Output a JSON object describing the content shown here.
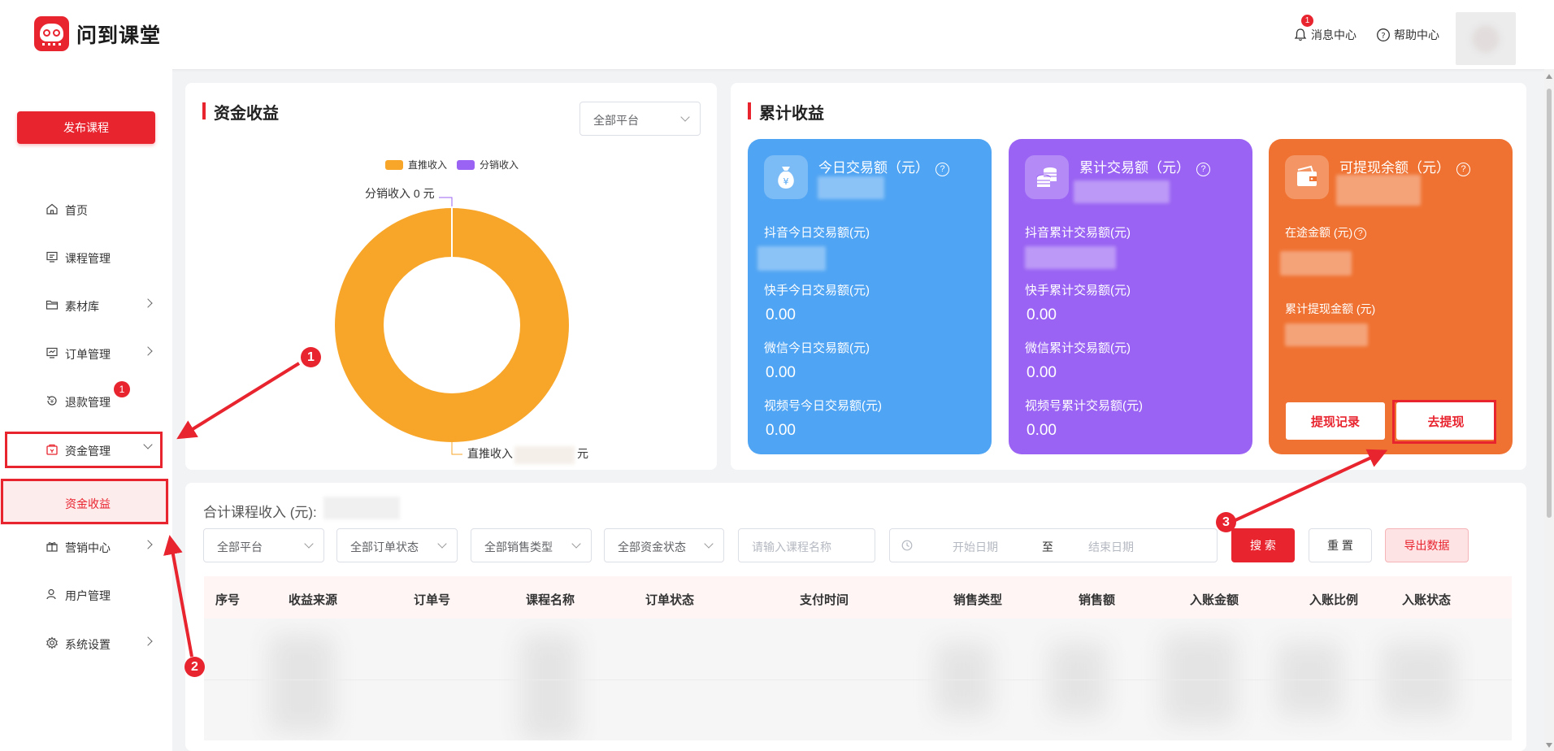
{
  "header": {
    "app_name": "问到课堂",
    "notifications_label": "消息中心",
    "notifications_badge": "1",
    "help_label": "帮助中心"
  },
  "sidebar": {
    "publish_label": "发布课程",
    "items": [
      {
        "label": "首页",
        "icon": "home-icon"
      },
      {
        "label": "课程管理",
        "icon": "course-icon"
      },
      {
        "label": "素材库",
        "icon": "folder-icon"
      },
      {
        "label": "订单管理",
        "icon": "order-icon"
      },
      {
        "label": "退款管理",
        "icon": "refund-icon",
        "badge": "1"
      },
      {
        "label": "资金管理",
        "icon": "wallet-icon"
      },
      {
        "label": "营销中心",
        "icon": "gift-icon"
      },
      {
        "label": "用户管理",
        "icon": "user-icon"
      },
      {
        "label": "系统设置",
        "icon": "settings-icon"
      }
    ],
    "sub_item": "资金收益"
  },
  "income_card": {
    "title": "资金收益",
    "platform_select": "全部平台",
    "legend": [
      "直推收入",
      "分销收入"
    ],
    "label_top": "分销收入 0 元",
    "label_bottom_prefix": "直推收入",
    "label_bottom_suffix": "元"
  },
  "chart_data": {
    "type": "pie",
    "categories": [
      "直推收入",
      "分销收入"
    ],
    "values": [
      1,
      0
    ],
    "colors": [
      "#f7a62a",
      "#9a63f3"
    ]
  },
  "cumulative_card": {
    "title": "累计收益",
    "today": {
      "title": "今日交易额（元）",
      "rows": [
        {
          "label": "抖音今日交易额(元)",
          "value": ""
        },
        {
          "label": "快手今日交易额(元)",
          "value": "0.00"
        },
        {
          "label": "微信今日交易额(元)",
          "value": "0.00"
        },
        {
          "label": "视频号今日交易额(元)",
          "value": "0.00"
        }
      ]
    },
    "total": {
      "title": "累计交易额（元）",
      "rows": [
        {
          "label": "抖音累计交易额(元)",
          "value": ""
        },
        {
          "label": "快手累计交易额(元)",
          "value": "0.00"
        },
        {
          "label": "微信累计交易额(元)",
          "value": "0.00"
        },
        {
          "label": "视频号累计交易额(元)",
          "value": "0.00"
        }
      ]
    },
    "withdrawable": {
      "title": "可提现余额（元）",
      "in_transit_label": "在途金额 (元)",
      "withdrawn_label": "累计提现金额 (元)",
      "records_button": "提现记录",
      "withdraw_button": "去提现"
    }
  },
  "table_section": {
    "total_label": "合计课程收入 (元):",
    "filters": {
      "platform": "全部平台",
      "order_status": "全部订单状态",
      "sales_type": "全部销售类型",
      "fund_status": "全部资金状态",
      "course_name_placeholder": "请输入课程名称",
      "start_date_placeholder": "开始日期",
      "date_separator": "至",
      "end_date_placeholder": "结束日期"
    },
    "buttons": {
      "search": "搜 索",
      "reset": "重 置",
      "export": "导出数据"
    },
    "columns": [
      "序号",
      "收益来源",
      "订单号",
      "课程名称",
      "订单状态",
      "支付时间",
      "销售类型",
      "销售额",
      "入账金额",
      "入账比例",
      "入账状态"
    ]
  },
  "annotations": [
    "1",
    "2",
    "3"
  ],
  "colors": {
    "brand_red": "#e8242f",
    "blue": "#4fa4f3",
    "purple": "#9a63f3",
    "orange": "#ef7232"
  }
}
